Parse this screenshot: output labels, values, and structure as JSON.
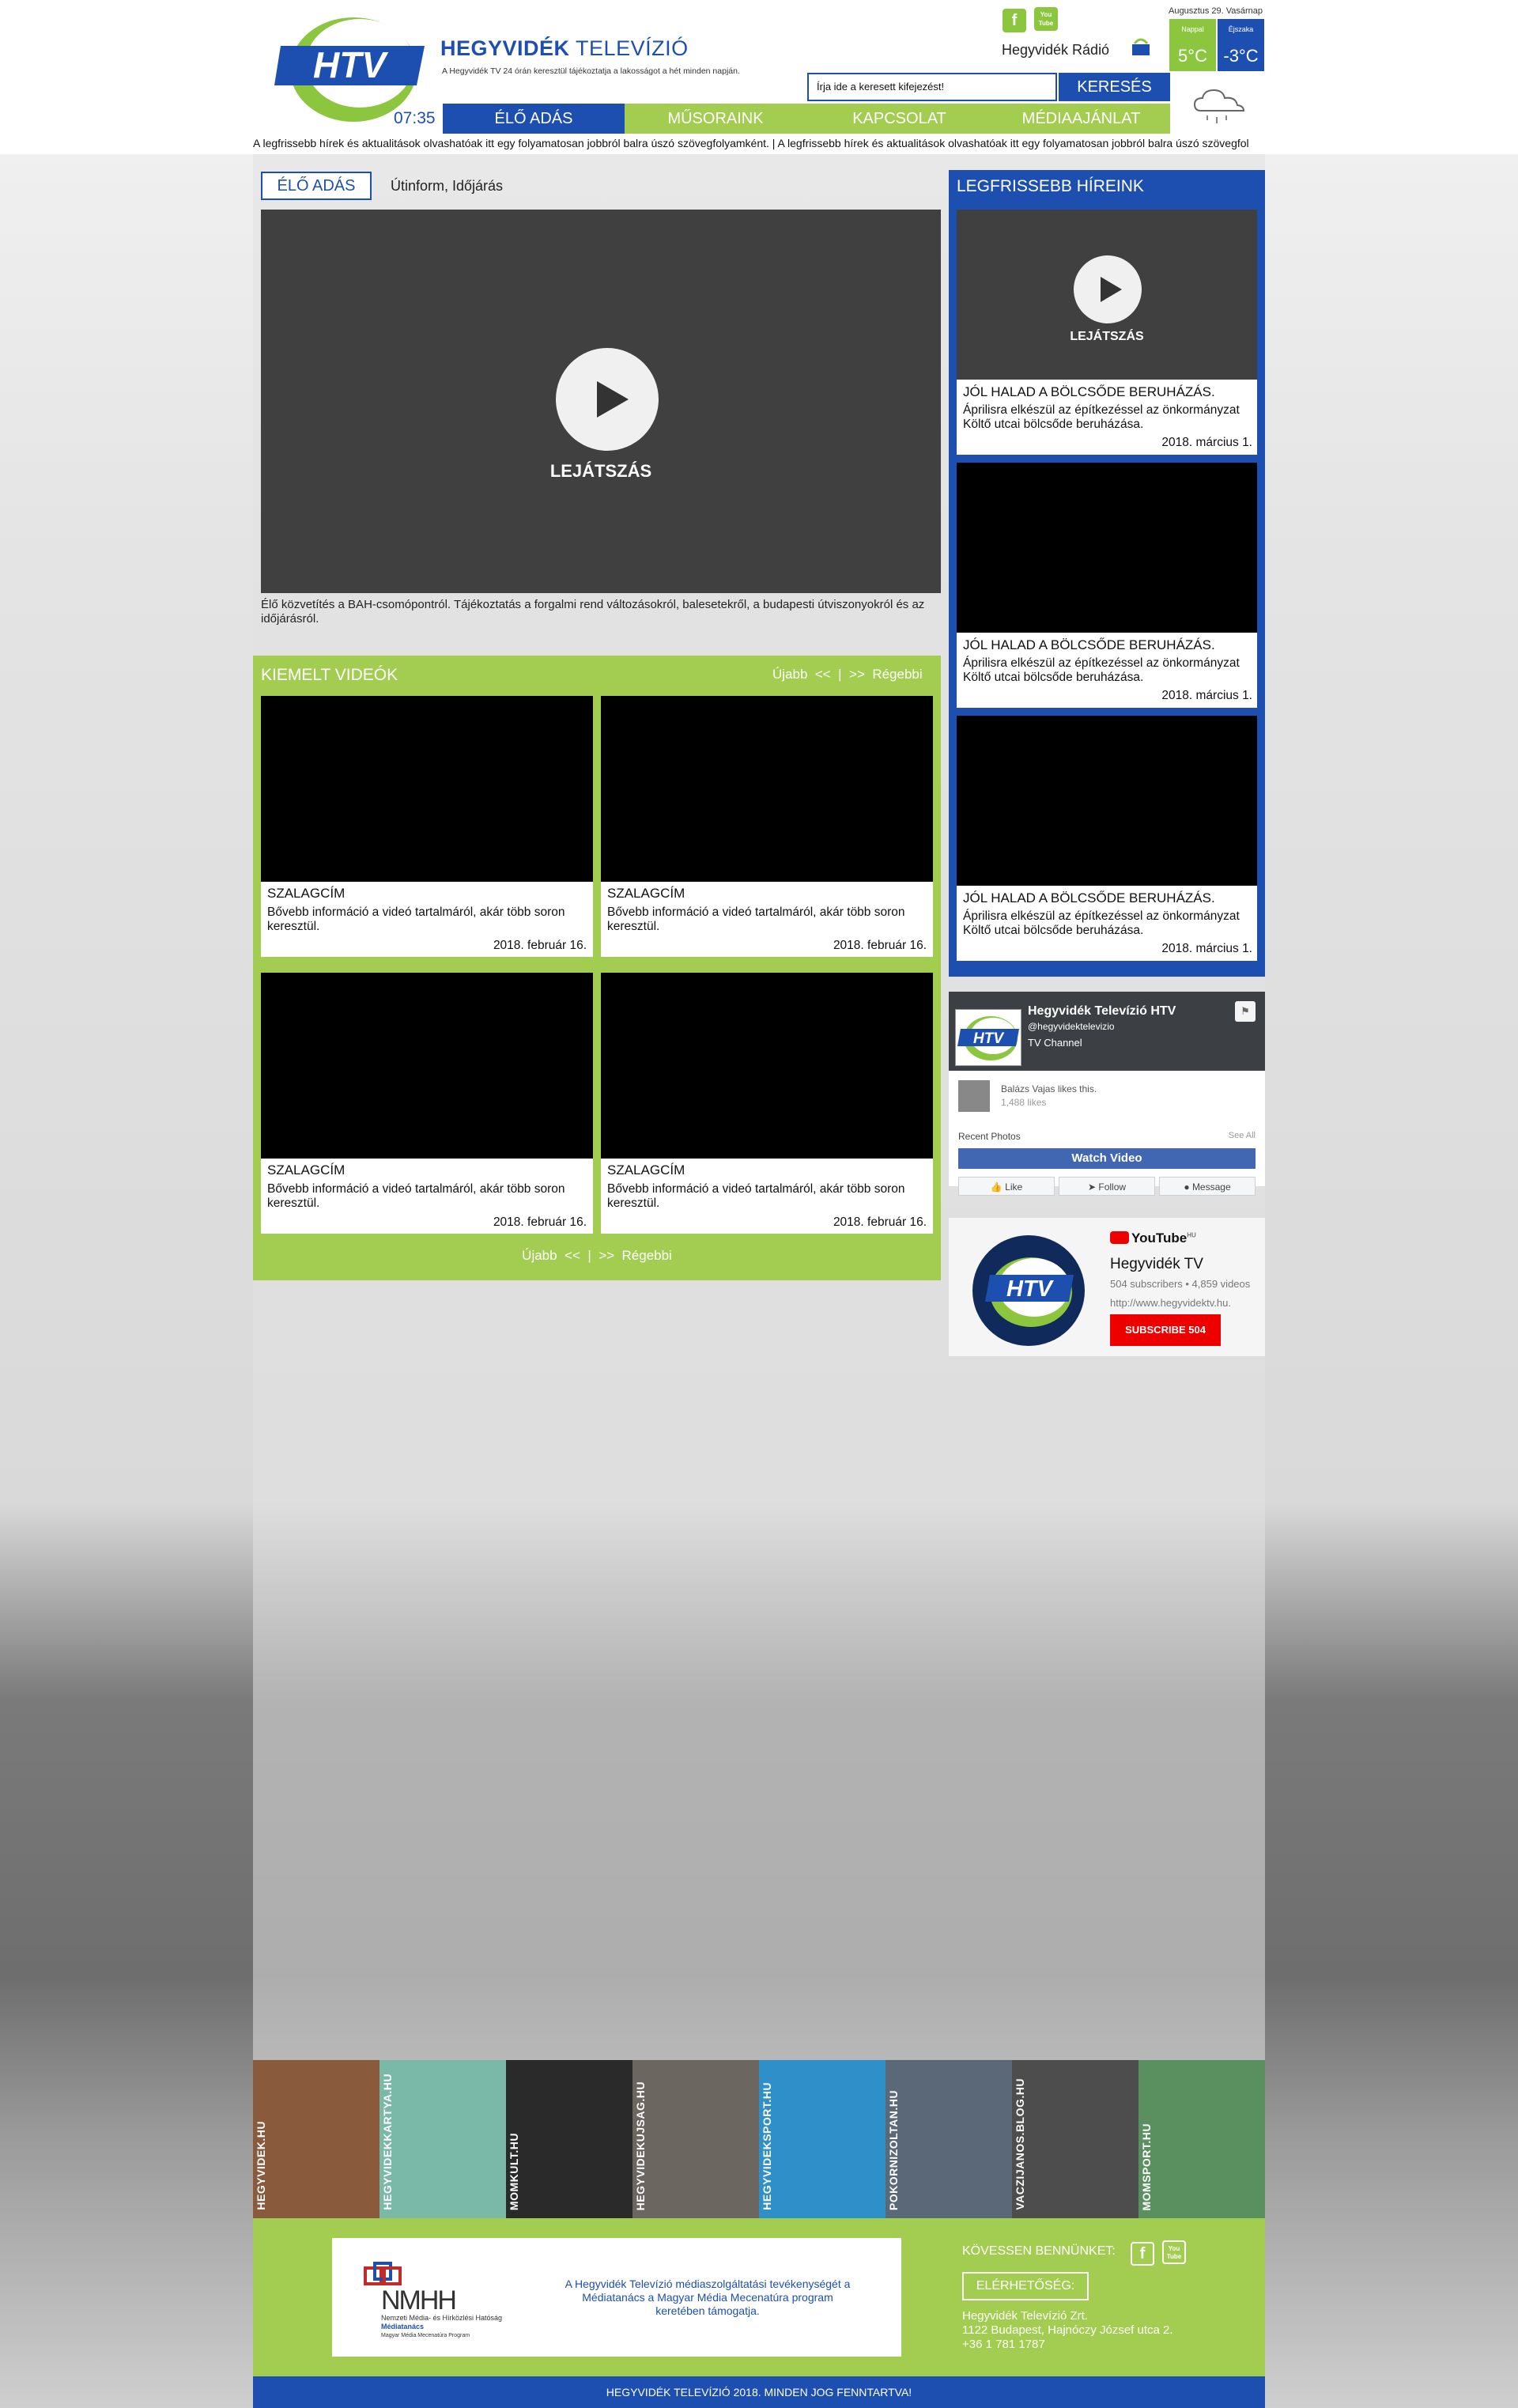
{
  "header": {
    "brand_bold": "HEGYVIDÉK",
    "brand_rest": " TELEVÍZIÓ",
    "tagline": "A Hegyvidék TV 24 órán keresztül tájékoztatja a lakosságot a hét minden napján.",
    "date": "Augusztus 29. Vasárnap",
    "radio_label": "Hegyvidék Rádió",
    "clock": "07:35",
    "logo_text": "HTV",
    "facebook_glyph": "f",
    "youtube_glyph": "You Tube"
  },
  "weather": {
    "day_label": "Nappal",
    "day_temp": "5°C",
    "night_label": "Éjszaka",
    "night_temp": "-3°C",
    "icon": "cloud-snow-icon",
    "day_color": "#8cc63f",
    "night_color": "#1d4fb0"
  },
  "search": {
    "placeholder": "Írja ide a keresett kifejezést!",
    "button": "KERESÉS"
  },
  "nav": [
    {
      "label": "ÉLŐ ADÁS",
      "color": "#1d4fb0"
    },
    {
      "label": "MŰSORAINK",
      "color": "#a3cd50"
    },
    {
      "label": "KAPCSOLAT",
      "color": "#a3cd50"
    },
    {
      "label": "MÉDIAAJÁNLAT",
      "color": "#a3cd50"
    }
  ],
  "ticker": "A legfrissebb hírek és aktualitások olvashatóak itt egy folyamatosan jobbról balra úszó szövegfolyamként.   |   A legfrissebb hírek és aktualitások olvashatóak itt egy folyamatosan jobbról balra úszó szövegfol",
  "live": {
    "tab": "ÉLŐ ADÁS",
    "subtitle": "Útinform, Időjárás",
    "play_label": "LEJÁTSZÁS",
    "description": "Élő közvetítés a BAH-csomópontról. Tájékoztatás a forgalmi rend változásokról, balesetekről, a budapesti útviszonyokról és az időjárásról."
  },
  "featured": {
    "title": "KIEMELT VIDEÓK",
    "nav": "Újabb  <<  |  >>  Régebbi",
    "videos": [
      {
        "title": "SZALAGCÍM",
        "desc": "Bővebb információ a videó tartalmáról, akár több soron keresztül.",
        "date": "2018. február 16."
      },
      {
        "title": "SZALAGCÍM",
        "desc": "Bővebb információ a videó tartalmáról, akár több soron keresztül.",
        "date": "2018. február 16."
      },
      {
        "title": "SZALAGCÍM",
        "desc": "Bővebb információ a videó tartalmáról, akár több soron keresztül.",
        "date": "2018. február 16."
      },
      {
        "title": "SZALAGCÍM",
        "desc": "Bővebb információ a videó tartalmáról, akár több soron keresztül.",
        "date": "2018. február 16."
      }
    ]
  },
  "news": {
    "title": "LEGFRISSEBB HÍREINK",
    "play_label": "LEJÁTSZÁS",
    "items": [
      {
        "title": "JÓL HALAD A BÖLCSŐDE BERUHÁZÁS.",
        "desc": "Áprilisra elkészül az építkezéssel az önkormányzat Költő utcai bölcsőde beruházása.",
        "date": "2018. március 1."
      },
      {
        "title": "JÓL HALAD A BÖLCSŐDE BERUHÁZÁS.",
        "desc": "Áprilisra elkészül az építkezéssel az önkormányzat Költő utcai bölcsőde beruházása.",
        "date": "2018. március 1."
      },
      {
        "title": "JÓL HALAD A BÖLCSŐDE BERUHÁZÁS.",
        "desc": "Áprilisra elkészül az építkezéssel az önkormányzat Költő utcai bölcsőde beruházása.",
        "date": "2018. március 1."
      }
    ]
  },
  "facebook": {
    "name": "Hegyvidék Televízió HTV",
    "handle": "@hegyvidektelevizio",
    "type": "TV Channel",
    "liked_by": "Balázs Vajas likes this.",
    "likes": "1,488 likes",
    "recent": "Recent Photos",
    "see_all": "See All",
    "watch": "Watch Video",
    "like": "Like",
    "follow": "Follow",
    "message": "Message"
  },
  "youtube": {
    "brand": "YouTube",
    "brand_suffix": "HU",
    "name": "Hegyvidék TV",
    "stats": "504 subscribers  •  4,859 videos",
    "url": "http://www.hegyvidektv.hu.",
    "subscribe": "SUBSCRIBE  504"
  },
  "partners": [
    {
      "label": "HEGYVIDEK.HU",
      "color": "#8a5a3c"
    },
    {
      "label": "HEGYVIDEKKARTYA.HU",
      "color": "#7ab8a8"
    },
    {
      "label": "MOMKULT.HU",
      "color": "#2a2a2a"
    },
    {
      "label": "HEGYVIDEKUJSAG.HU",
      "color": "#6c6660"
    },
    {
      "label": "HEGYVIDEKSPORT.HU",
      "color": "#2f8fc8"
    },
    {
      "label": "POKORNIZOLTAN.HU",
      "color": "#5a6878"
    },
    {
      "label": "VACZIJANOS.BLOG.HU",
      "color": "#4d4d4d"
    },
    {
      "label": "MOMSPORT.HU",
      "color": "#5a8f60"
    }
  ],
  "footer": {
    "nmhh_name": "NMHH",
    "nmhh_sub": "Nemzeti Média- és Hírközlési Hatóság",
    "nmhh_sub2": "Médiatanács",
    "nmhh_sub3": "Magyar Média Mecenatúra Program",
    "nmhh_text": "A Hegyvidék Televízió médiaszolgáltatási tevékenységét a Médiatanács a Magyar Média Mecenatúra program keretében támogatja.",
    "follow": "KÖVESSEN BENNÜNKET:",
    "contact": "ELÉRHETŐSÉG:",
    "company": "Hegyvidék Televízió Zrt.",
    "address": "1122 Budapest, Hajnóczy József utca 2.",
    "phone": "+36 1 781 1787",
    "copyright": "HEGYVIDÉK TELEVÍZIÓ 2018. MINDEN JOG FENNTARTVA!"
  }
}
